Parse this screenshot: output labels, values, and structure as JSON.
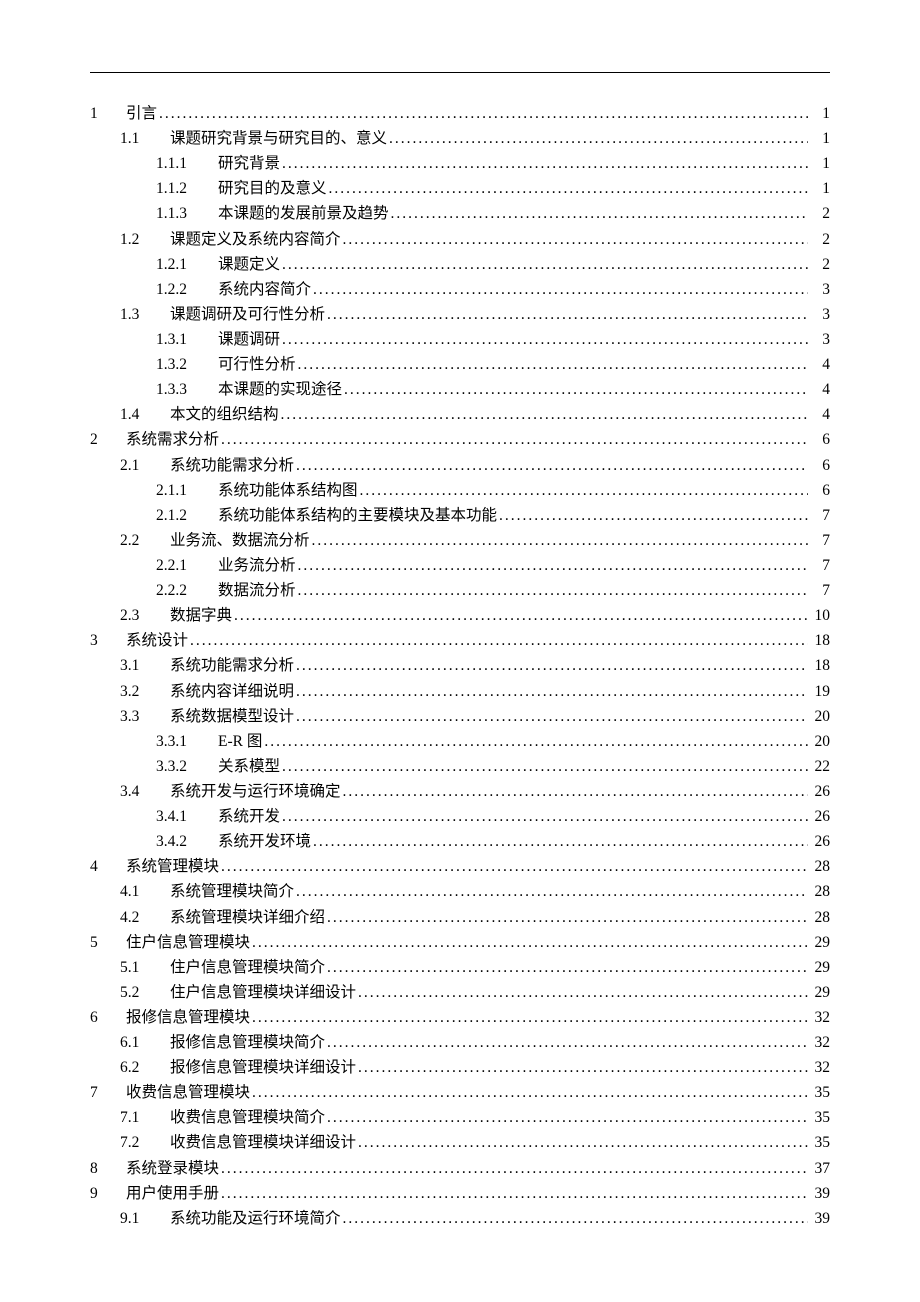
{
  "toc": [
    {
      "level": 1,
      "num": "1",
      "title": "引言",
      "page": "1"
    },
    {
      "level": 2,
      "num": "1.1",
      "title": "课题研究背景与研究目的、意义",
      "page": "1"
    },
    {
      "level": 3,
      "num": "1.1.1",
      "title": "研究背景",
      "page": "1"
    },
    {
      "level": 3,
      "num": "1.1.2",
      "title": "研究目的及意义",
      "page": "1"
    },
    {
      "level": 3,
      "num": "1.1.3",
      "title": "本课题的发展前景及趋势",
      "page": "2"
    },
    {
      "level": 2,
      "num": "1.2",
      "title": "课题定义及系统内容简介",
      "page": "2"
    },
    {
      "level": 3,
      "num": "1.2.1",
      "title": "课题定义",
      "page": "2"
    },
    {
      "level": 3,
      "num": "1.2.2",
      "title": "系统内容简介",
      "page": "3"
    },
    {
      "level": 2,
      "num": "1.3",
      "title": "课题调研及可行性分析",
      "page": "3"
    },
    {
      "level": 3,
      "num": "1.3.1",
      "title": "课题调研",
      "page": "3"
    },
    {
      "level": 3,
      "num": "1.3.2",
      "title": "可行性分析",
      "page": "4"
    },
    {
      "level": 3,
      "num": "1.3.3",
      "title": "本课题的实现途径",
      "page": "4"
    },
    {
      "level": 2,
      "num": "1.4",
      "title": "本文的组织结构",
      "page": "4"
    },
    {
      "level": 1,
      "num": "2",
      "title": "系统需求分析",
      "page": "6"
    },
    {
      "level": 2,
      "num": "2.1",
      "title": "系统功能需求分析",
      "page": "6"
    },
    {
      "level": 3,
      "num": "2.1.1",
      "title": "系统功能体系结构图",
      "page": "6"
    },
    {
      "level": 3,
      "num": "2.1.2",
      "title": "系统功能体系结构的主要模块及基本功能",
      "page": "7"
    },
    {
      "level": 2,
      "num": "2.2",
      "title": "业务流、数据流分析",
      "page": "7"
    },
    {
      "level": 3,
      "num": "2.2.1",
      "title": "业务流分析",
      "page": "7"
    },
    {
      "level": 3,
      "num": "2.2.2",
      "title": "数据流分析",
      "page": "7"
    },
    {
      "level": 2,
      "num": "2.3",
      "title": "数据字典",
      "page": "10"
    },
    {
      "level": 1,
      "num": "3",
      "title": "系统设计",
      "page": "18"
    },
    {
      "level": 2,
      "num": "3.1",
      "title": "系统功能需求分析",
      "page": "18"
    },
    {
      "level": 2,
      "num": "3.2",
      "title": "系统内容详细说明",
      "page": "19"
    },
    {
      "level": 2,
      "num": "3.3",
      "title": "系统数据模型设计",
      "page": "20"
    },
    {
      "level": 3,
      "num": "3.3.1",
      "title": "E-R 图",
      "page": "20"
    },
    {
      "level": 3,
      "num": "3.3.2",
      "title": "关系模型",
      "page": "22"
    },
    {
      "level": 2,
      "num": "3.4",
      "title": "系统开发与运行环境确定",
      "page": "26"
    },
    {
      "level": 3,
      "num": "3.4.1",
      "title": "系统开发",
      "page": "26"
    },
    {
      "level": 3,
      "num": "3.4.2",
      "title": "系统开发环境",
      "page": "26"
    },
    {
      "level": 1,
      "num": "4",
      "title": "系统管理模块",
      "page": "28"
    },
    {
      "level": 2,
      "num": "4.1",
      "title": "系统管理模块简介",
      "page": "28"
    },
    {
      "level": 2,
      "num": "4.2",
      "title": "系统管理模块详细介绍",
      "page": "28"
    },
    {
      "level": 1,
      "num": "5",
      "title": "住户信息管理模块",
      "page": "29"
    },
    {
      "level": 2,
      "num": "5.1",
      "title": "住户信息管理模块简介",
      "page": "29"
    },
    {
      "level": 2,
      "num": "5.2",
      "title": "住户信息管理模块详细设计",
      "page": "29"
    },
    {
      "level": 1,
      "num": "6",
      "title": "报修信息管理模块",
      "page": "32"
    },
    {
      "level": 2,
      "num": "6.1",
      "title": "报修信息管理模块简介",
      "page": "32"
    },
    {
      "level": 2,
      "num": "6.2",
      "title": "报修信息管理模块详细设计",
      "page": "32"
    },
    {
      "level": 1,
      "num": "7",
      "title": "收费信息管理模块",
      "page": "35"
    },
    {
      "level": 2,
      "num": "7.1",
      "title": "收费信息管理模块简介",
      "page": "35"
    },
    {
      "level": 2,
      "num": "7.2",
      "title": "收费信息管理模块详细设计",
      "page": "35"
    },
    {
      "level": 1,
      "num": "8",
      "title": "系统登录模块",
      "page": "37"
    },
    {
      "level": 1,
      "num": "9",
      "title": "用户使用手册",
      "page": "39"
    },
    {
      "level": 2,
      "num": "9.1",
      "title": "系统功能及运行环境简介",
      "page": "39"
    }
  ]
}
